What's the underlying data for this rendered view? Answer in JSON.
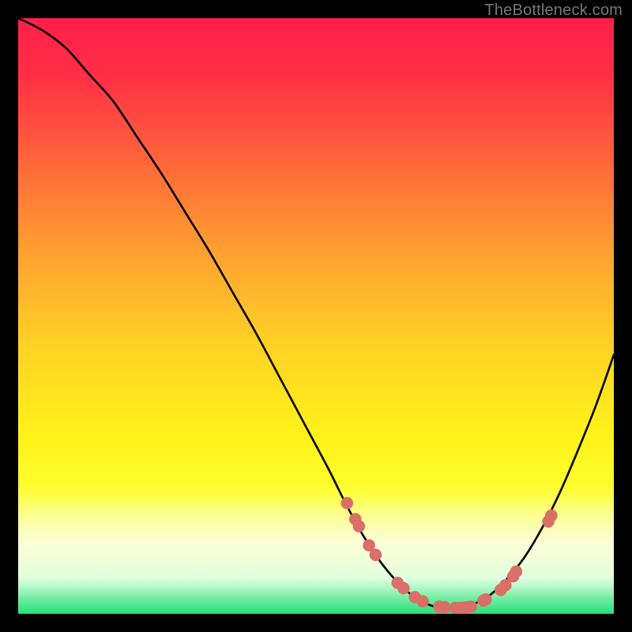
{
  "watermark": "TheBottleneck.com",
  "chart_data": {
    "type": "line",
    "title": "",
    "xlabel": "",
    "ylabel": "",
    "xlim": [
      0,
      100
    ],
    "ylim": [
      0,
      100
    ],
    "grid": false,
    "series": [
      {
        "name": "curve",
        "x": [
          0,
          4,
          8,
          12,
          16,
          20,
          24,
          28,
          32,
          36,
          40,
          44,
          48,
          52,
          55,
          58,
          61,
          64,
          67,
          70,
          73,
          76,
          79,
          82,
          85,
          88,
          91,
          94,
          97,
          100
        ],
        "y": [
          100,
          98,
          95,
          90.5,
          86,
          80,
          74,
          67.5,
          61,
          54,
          47,
          39.5,
          32,
          24.5,
          18.5,
          13,
          8.5,
          5,
          2.5,
          1.2,
          1,
          1.5,
          3,
          5.8,
          9.5,
          14.5,
          20.5,
          27.5,
          35,
          43.5
        ]
      }
    ],
    "markers": {
      "name": "dots",
      "color": "#da6f67",
      "points": [
        {
          "x": 55.2,
          "y": 18.6
        },
        {
          "x": 56.6,
          "y": 15.9
        },
        {
          "x": 57.2,
          "y": 14.7
        },
        {
          "x": 58.9,
          "y": 11.5
        },
        {
          "x": 60.0,
          "y": 9.9
        },
        {
          "x": 63.7,
          "y": 5.2
        },
        {
          "x": 64.7,
          "y": 4.3
        },
        {
          "x": 66.6,
          "y": 2.8
        },
        {
          "x": 67.9,
          "y": 2.1
        },
        {
          "x": 70.7,
          "y": 1.2
        },
        {
          "x": 71.6,
          "y": 1.1
        },
        {
          "x": 73.4,
          "y": 1.0
        },
        {
          "x": 74.3,
          "y": 1.0
        },
        {
          "x": 74.8,
          "y": 1.0
        },
        {
          "x": 75.3,
          "y": 1.1
        },
        {
          "x": 76.0,
          "y": 1.2
        },
        {
          "x": 78.1,
          "y": 2.2
        },
        {
          "x": 78.5,
          "y": 2.4
        },
        {
          "x": 81.0,
          "y": 4.0
        },
        {
          "x": 81.8,
          "y": 4.8
        },
        {
          "x": 83.1,
          "y": 6.3
        },
        {
          "x": 83.6,
          "y": 7.1
        },
        {
          "x": 89.0,
          "y": 15.5
        },
        {
          "x": 89.5,
          "y": 16.5
        }
      ]
    },
    "gradient_stops": [
      {
        "offset": 0.0,
        "color": "#ff1f4a"
      },
      {
        "offset": 0.1,
        "color": "#ff3045"
      },
      {
        "offset": 0.25,
        "color": "#ff6a3a"
      },
      {
        "offset": 0.4,
        "color": "#ffa330"
      },
      {
        "offset": 0.55,
        "color": "#ffd225"
      },
      {
        "offset": 0.7,
        "color": "#fff21a"
      },
      {
        "offset": 0.8,
        "color": "#ffff30"
      },
      {
        "offset": 0.88,
        "color": "#f6ffa8"
      },
      {
        "offset": 0.94,
        "color": "#d8ffd8"
      },
      {
        "offset": 1.0,
        "color": "#24e07a"
      }
    ],
    "fade_band": {
      "y_start": 0.78,
      "y_end": 0.97
    }
  }
}
